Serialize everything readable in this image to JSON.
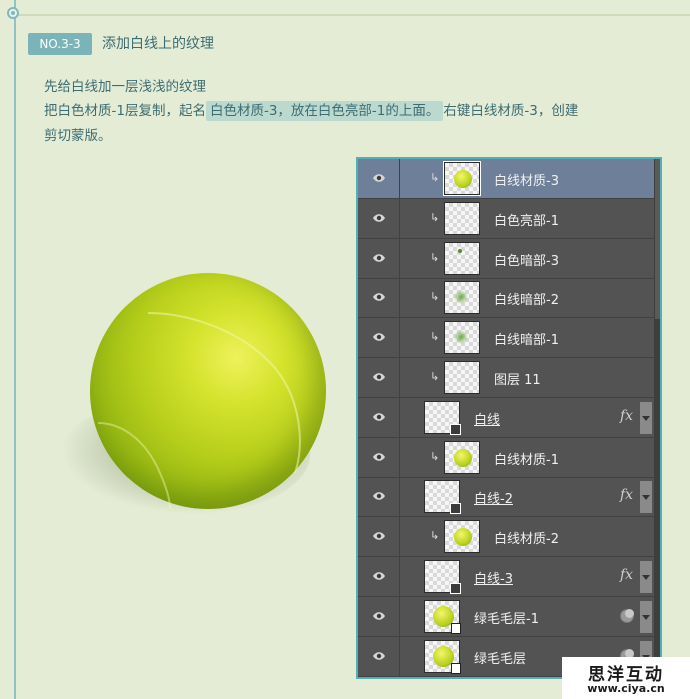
{
  "section": {
    "badge": "NO.3-3",
    "title": "添加白线上的纹理"
  },
  "instructions": {
    "line1": "先给白线加一层浅浅的纹理",
    "line2_pre": "把白色材质-1层复制，起名",
    "line2_highlight": "白色材质-3，放在白色亮部-1的上面。",
    "line2_post": "右键白线材质-3，创建",
    "line3": "剪切蒙版。"
  },
  "layers_panel": {
    "layers": [
      {
        "name": "白线材质-3",
        "kind": "clipped",
        "thumb": "ball",
        "selected": true
      },
      {
        "name": "白色亮部-1",
        "kind": "clipped",
        "thumb": "transparent"
      },
      {
        "name": "白色暗部-3",
        "kind": "clipped",
        "thumb": "small-dot"
      },
      {
        "name": "白线暗部-2",
        "kind": "clipped",
        "thumb": "green-blur"
      },
      {
        "name": "白线暗部-1",
        "kind": "clipped",
        "thumb": "green-blur"
      },
      {
        "name": "图层 11",
        "kind": "clipped",
        "thumb": "transparent"
      },
      {
        "name": "白线",
        "kind": "base",
        "thumb": "transparent",
        "fx": "fx"
      },
      {
        "name": "白线材质-1",
        "kind": "clipped",
        "thumb": "ball"
      },
      {
        "name": "白线-2",
        "kind": "base",
        "thumb": "transparent",
        "fx": "fx"
      },
      {
        "name": "白线材质-2",
        "kind": "clipped",
        "thumb": "ball"
      },
      {
        "name": "白线-3",
        "kind": "base",
        "thumb": "transparent",
        "fx": "fx"
      },
      {
        "name": "绿毛毛层-1",
        "kind": "smart",
        "thumb": "ball"
      },
      {
        "name": "绿毛毛层",
        "kind": "smart",
        "thumb": "ball"
      }
    ],
    "icons": {
      "visibility": "eye-icon",
      "clip": "clipping-arrow-icon",
      "effects": "fx-icon",
      "filter_mask": "filter-mask-icon",
      "expand": "expand-arrow-icon"
    }
  },
  "watermark": {
    "name": "思洋互动",
    "url": "www.ciya.cn"
  },
  "colors": {
    "accent": "#7ab4b8",
    "highlight": "#bcd9d0",
    "text": "#3d6c72",
    "panel_bg": "#535353",
    "selected_row": "#6e7f99",
    "ball": "#c5da24"
  }
}
